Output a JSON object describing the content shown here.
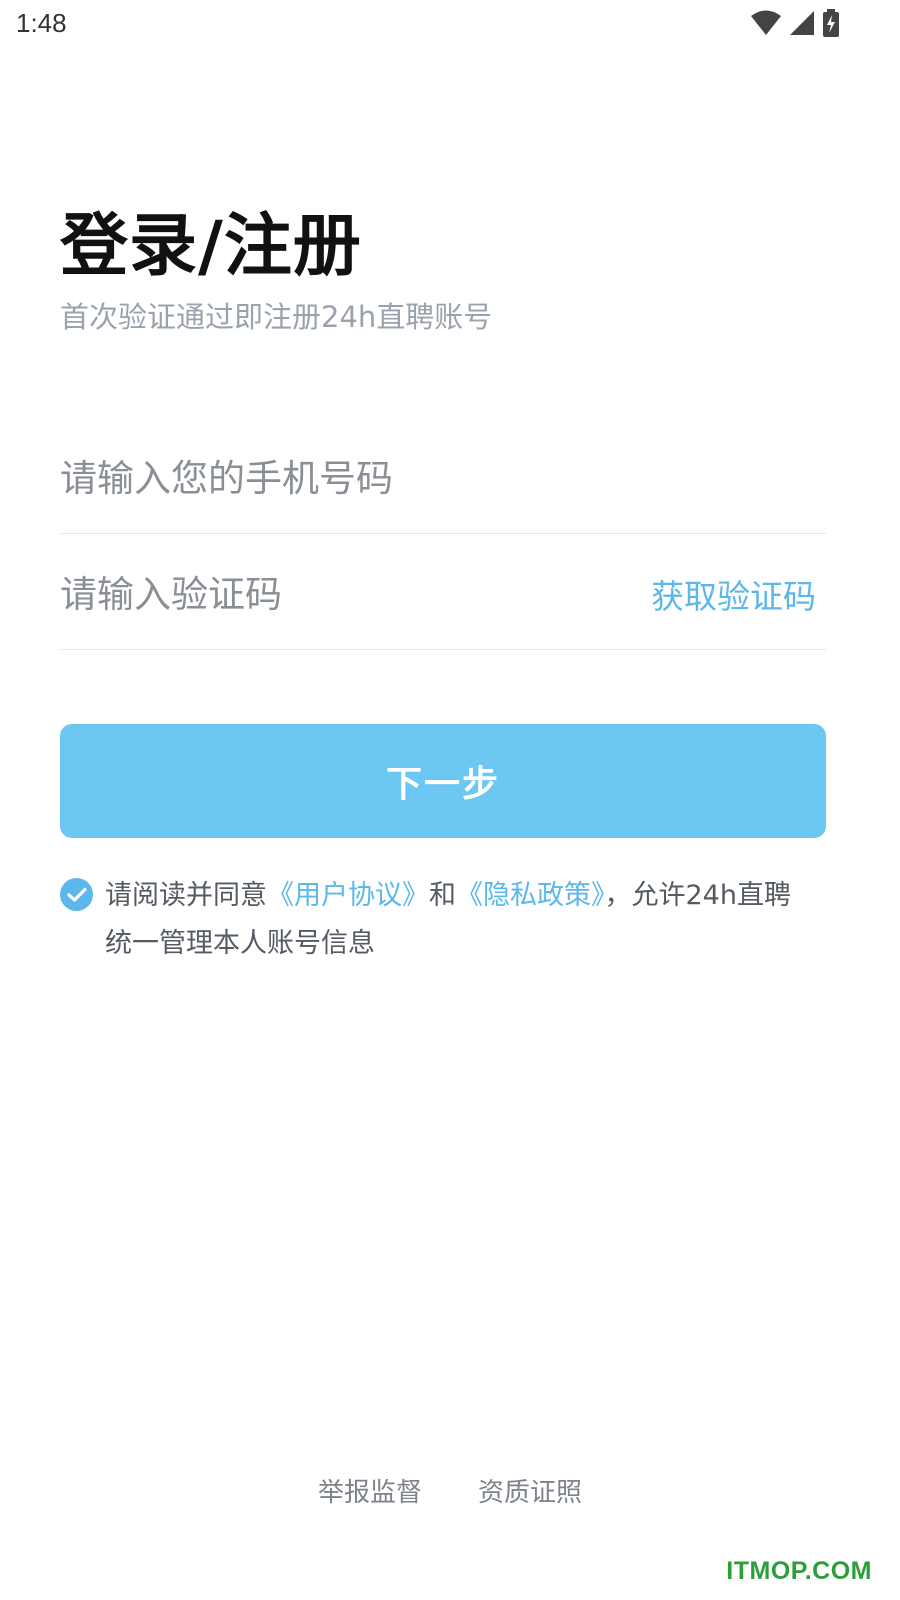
{
  "status_bar": {
    "time": "1:48",
    "icons": [
      "wifi-icon",
      "signal-icon",
      "battery-charging-icon"
    ]
  },
  "header": {
    "title": "登录/注册",
    "subtitle": "首次验证通过即注册24h直聘账号"
  },
  "form": {
    "phone_placeholder": "请输入您的手机号码",
    "phone_value": "",
    "code_placeholder": "请输入验证码",
    "code_value": "",
    "get_code_label": "获取验证码"
  },
  "next_button_label": "下一步",
  "agreement": {
    "checked": true,
    "prefix": "请阅读并同意",
    "user_agreement": "《用户协议》",
    "conjunction": "和",
    "privacy_policy": "《隐私政策》",
    "suffix": "，允许24h直聘统一管理本人账号信息"
  },
  "footer": {
    "report_label": "举报监督",
    "qualification_label": "资质证照"
  },
  "watermark": "ITMOP.COM",
  "colors": {
    "accent": "#5cb8ea",
    "button_bg": "#6cc7f3",
    "watermark": "#2e9e3a"
  }
}
